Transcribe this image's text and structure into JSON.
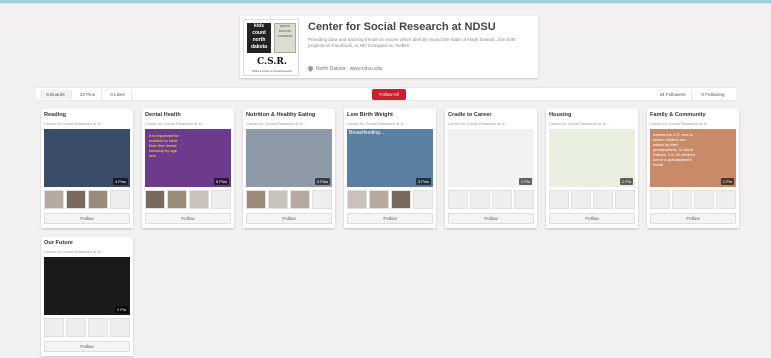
{
  "profile": {
    "title": "Center for Social Research at NDSU",
    "description": "Providing data and tracking trends on issues which directly impact the state of North Dakota. Join both projects on Facebook, or ND Compass on Twitter!",
    "location": "North Dakota · www.ndsu.edu",
    "logo_text": "C.S.R.",
    "logo_sub": "NDSU ● Center for Social Research",
    "kids_lines": [
      "kids",
      "count",
      "north",
      "dakota"
    ],
    "compass_lines": [
      "NORTH DAKOTA",
      "COMPASS"
    ]
  },
  "stats": {
    "boards": "8 Boards",
    "pins": "22 Pins",
    "likes": "0 Likes",
    "follow_all": "Follow All",
    "followers": "34 Followers",
    "following": "0 Following"
  },
  "boards": [
    {
      "title": "Reading",
      "owner": "Center for Social Research at N...",
      "pins": "4 Pins",
      "follow": "Follow",
      "cover_color": "#3b4b6a"
    },
    {
      "title": "Dental Health",
      "owner": "Center for Social Research at N...",
      "pins": "5 Pins",
      "follow": "Follow",
      "cover_color": "#6d3a8c",
      "cover_text": "It is important for toddlers to have their first dental checkup by age one."
    },
    {
      "title": "Nutrition & Healthy Eating",
      "owner": "Center for Social Research at N...",
      "pins": "4 Pins",
      "follow": "Follow",
      "cover_color": "#8f9aa8"
    },
    {
      "title": "Low Birth Weight",
      "owner": "Center for Social Research at N...",
      "pins": "3 Pins",
      "follow": "Follow",
      "cover_color": "#5b7fa0",
      "cover_text": "Breastfeeding..."
    },
    {
      "title": "Cradle to Career",
      "owner": "Center for Social Research at N...",
      "pins": "1 Pin",
      "follow": "Follow",
      "cover_color": "#f2f2f2"
    },
    {
      "title": "Housing",
      "owner": "Center for Social Research at N...",
      "pins": "1 Pin",
      "follow": "Follow",
      "cover_color": "#e8efe0"
    },
    {
      "title": "Family & Community",
      "owner": "Center for Social Research at N...",
      "pins": "1 Pin",
      "follow": "Follow",
      "cover_color": "#c98a6a",
      "cover_text": "Across the U.S. one in seven children are raised by their grandparents. In North Dakota, 1 in 25 children live in a grandparent's home."
    },
    {
      "title": "Our Future",
      "owner": "Center for Social Research at N...",
      "pins": "1 Pin",
      "follow": "Follow",
      "cover_color": "#1a1a1a"
    }
  ]
}
